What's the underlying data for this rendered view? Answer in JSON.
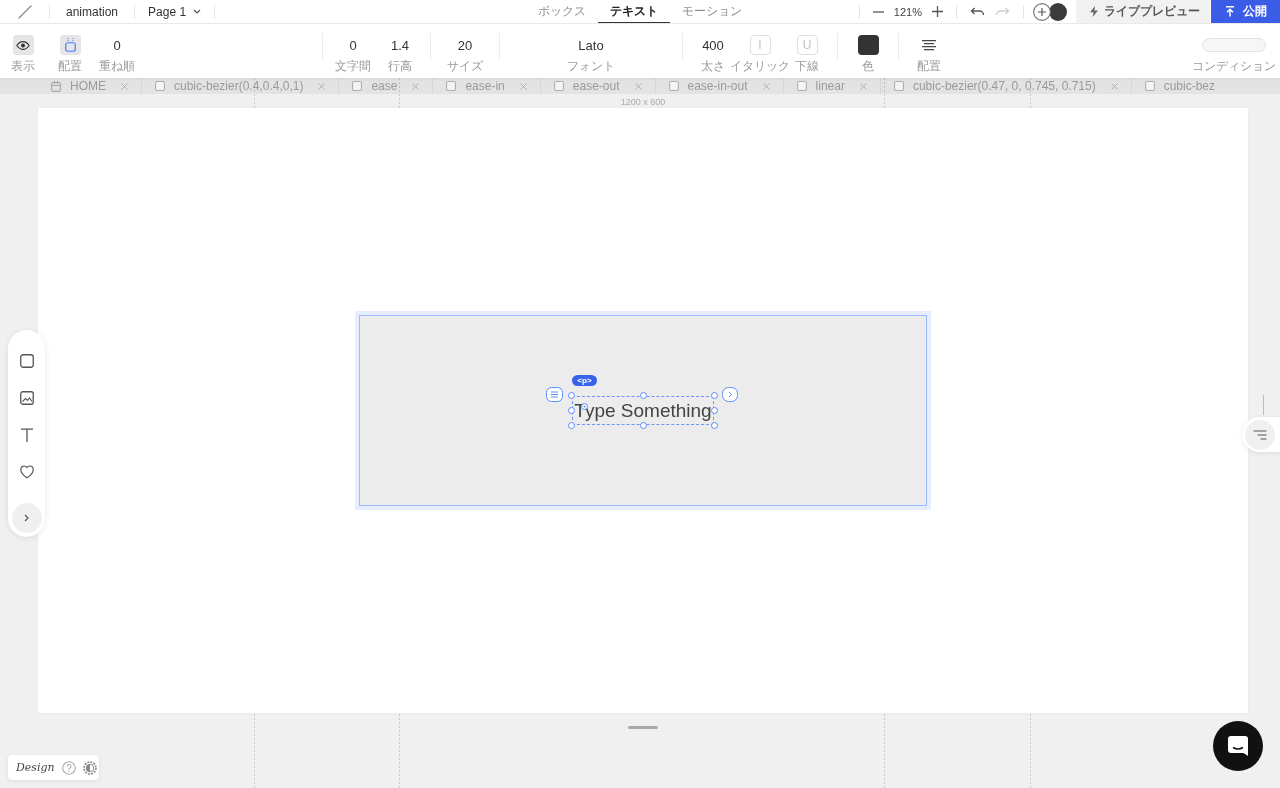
{
  "top_bar": {
    "document_title": "animation",
    "page_menu": "Page 1",
    "tabs": [
      {
        "label": "ボックス",
        "selected": false
      },
      {
        "label": "テキスト",
        "selected": true
      },
      {
        "label": "モーション",
        "selected": false
      }
    ],
    "zoom": "121%",
    "history": [
      {
        "kind": "undo",
        "disabled": false
      },
      {
        "kind": "redo",
        "disabled": true
      }
    ],
    "live_preview_button": "ライブプレビュー",
    "publish_button": "公開"
  },
  "property_bar": {
    "groups": [
      {
        "items": [
          {
            "kind": "visibility",
            "label": "表示",
            "on": true
          },
          {
            "kind": "placement",
            "label": "配置",
            "on": true
          },
          {
            "kind": "value",
            "value": "0",
            "label": "重ね順"
          }
        ]
      },
      {
        "items": [
          {
            "kind": "value",
            "value": "0",
            "label": "文字間"
          },
          {
            "kind": "value",
            "value": "1.4",
            "label": "行高"
          }
        ]
      },
      {
        "items": [
          {
            "kind": "value",
            "value": "20",
            "label": "サイズ"
          }
        ]
      },
      {
        "items": [
          {
            "kind": "font",
            "value": "Lato",
            "label": "フォント"
          }
        ]
      },
      {
        "items": [
          {
            "kind": "value",
            "value": "400",
            "label": "太さ"
          },
          {
            "kind": "style",
            "glyph": "I",
            "label": "イタリック",
            "on": false
          },
          {
            "kind": "style",
            "glyph": "U",
            "label": "下線",
            "on": false
          }
        ]
      },
      {
        "items": [
          {
            "kind": "color",
            "color": "#333333",
            "label": "色"
          }
        ]
      },
      {
        "items": [
          {
            "kind": "align",
            "label": "配置"
          }
        ]
      },
      {
        "items": [
          {
            "kind": "field",
            "label": "コンディション"
          }
        ]
      }
    ]
  },
  "motion_strip": {
    "items": [
      {
        "kind": "page",
        "label": "HOME",
        "closable": true
      },
      {
        "kind": "checkbox",
        "checked": false,
        "label": "cubic-bezier(0.4,0.4,0,1)",
        "closable": true
      },
      {
        "kind": "checkbox",
        "checked": false,
        "label": "ease",
        "closable": true
      },
      {
        "kind": "checkbox",
        "checked": false,
        "label": "ease-in",
        "closable": true
      },
      {
        "kind": "checkbox",
        "checked": false,
        "label": "ease-out",
        "closable": true
      },
      {
        "kind": "checkbox",
        "checked": false,
        "label": "ease-in-out",
        "closable": true
      },
      {
        "kind": "checkbox",
        "checked": false,
        "label": "linear",
        "closable": true
      },
      {
        "kind": "checkbox",
        "checked": false,
        "label": "cubic-bezier(0.47, 0, 0.745, 0.715)",
        "closable": true
      },
      {
        "kind": "checkbox",
        "checked": false,
        "label": "cubic-bez",
        "closable": false
      }
    ]
  },
  "canvas": {
    "size_label": "1200 x 600",
    "element": {
      "tag": "<p>",
      "text": "Type Something"
    }
  },
  "footer": {
    "brand": "Design"
  }
}
